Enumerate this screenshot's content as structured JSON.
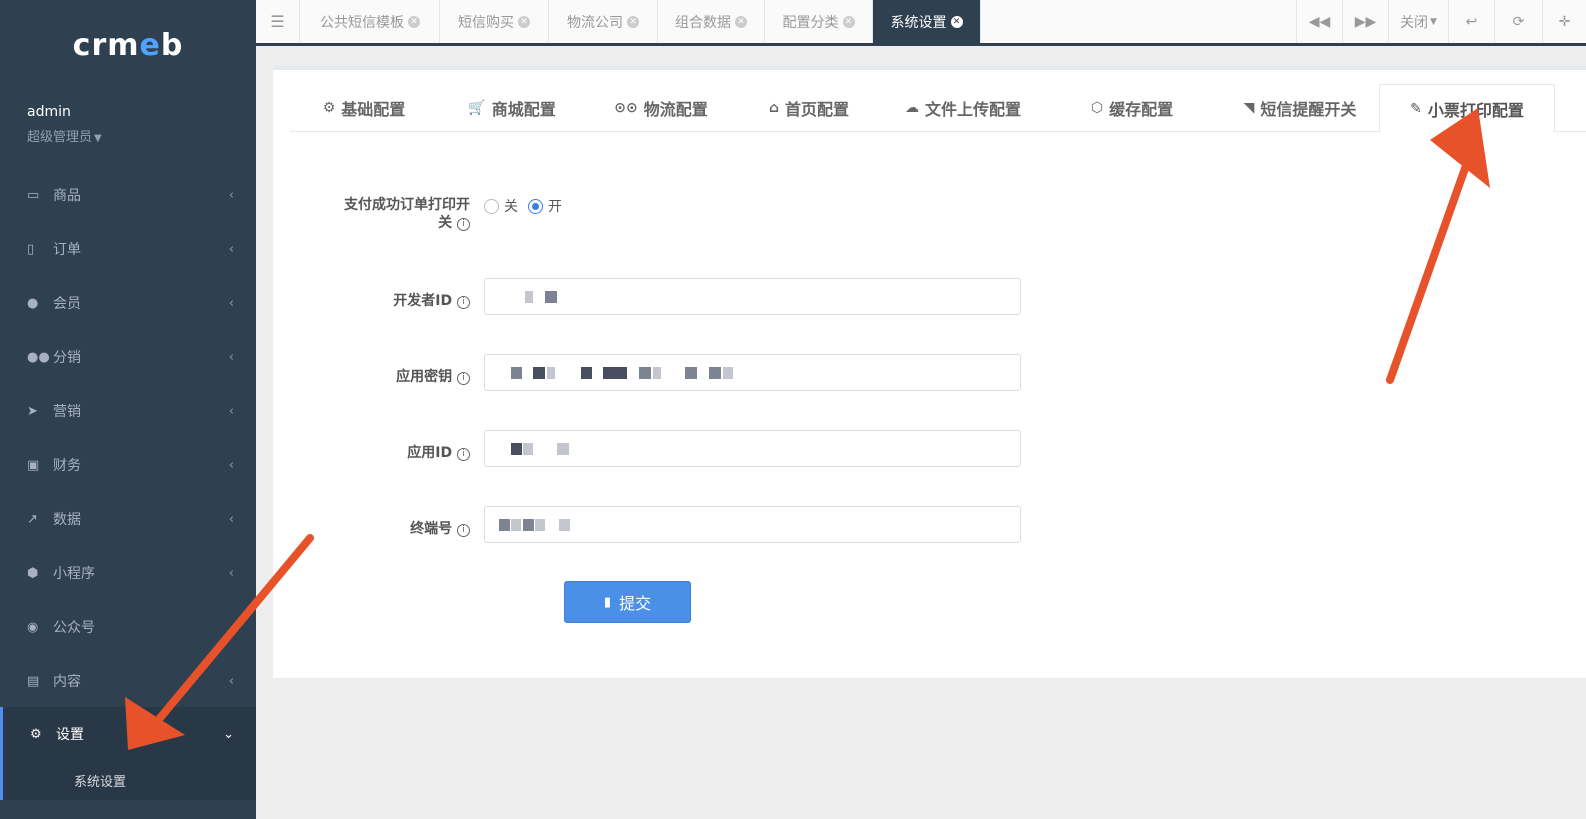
{
  "app": {
    "logo": "crmeb",
    "user": {
      "name": "admin",
      "role": "超级管理员"
    }
  },
  "sidebar": {
    "items": [
      {
        "label": "商品",
        "icon": "laptop-icon",
        "glyph": "💻"
      },
      {
        "label": "订单",
        "icon": "building-icon",
        "glyph": "▦"
      },
      {
        "label": "会员",
        "icon": "user-icon",
        "glyph": "●"
      },
      {
        "label": "分销",
        "icon": "users-icon",
        "glyph": "👥"
      },
      {
        "label": "营销",
        "icon": "paper-plane-icon",
        "glyph": "➤"
      },
      {
        "label": "财务",
        "icon": "money-icon",
        "glyph": "▣"
      },
      {
        "label": "数据",
        "icon": "line-chart-icon",
        "glyph": "📈"
      },
      {
        "label": "小程序",
        "icon": "cubes-icon",
        "glyph": "⬢"
      },
      {
        "label": "公众号",
        "icon": "wechat-icon",
        "glyph": "💬"
      },
      {
        "label": "内容",
        "icon": "newspaper-icon",
        "glyph": "▤"
      },
      {
        "label": "设置",
        "icon": "gear-icon",
        "glyph": "⚙"
      }
    ],
    "sub_item": "系统设置"
  },
  "topbar": {
    "tabs": [
      {
        "label": "公共短信模板"
      },
      {
        "label": "短信购买"
      },
      {
        "label": "物流公司"
      },
      {
        "label": "组合数据"
      },
      {
        "label": "配置分类"
      },
      {
        "label": "系统设置"
      }
    ],
    "close_label": "关闭"
  },
  "config_tabs": [
    {
      "label": "基础配置",
      "icon": "gear-icon",
      "glyph": "⚙"
    },
    {
      "label": "商城配置",
      "icon": "cart-icon",
      "glyph": "🛒"
    },
    {
      "label": "物流配置",
      "icon": "motorcycle-icon",
      "glyph": "🏍"
    },
    {
      "label": "首页配置",
      "icon": "home-icon",
      "glyph": "⌂"
    },
    {
      "label": "文件上传配置",
      "icon": "cloud-upload-icon",
      "glyph": "☁"
    },
    {
      "label": "缓存配置",
      "icon": "cube-icon",
      "glyph": "⬡"
    },
    {
      "label": "短信提醒开关",
      "icon": "rss-icon",
      "glyph": "◠"
    },
    {
      "label": "小票打印配置",
      "icon": "plug-icon",
      "glyph": "🔌"
    }
  ],
  "form": {
    "print_switch": {
      "label_line1": "支付成功订单打印开",
      "label_line2": "关",
      "options": [
        "关",
        "开"
      ],
      "selected": "开"
    },
    "developer_id": {
      "label": "开发者ID"
    },
    "app_secret": {
      "label": "应用密钥"
    },
    "app_id": {
      "label": "应用ID"
    },
    "terminal_no": {
      "label": "终端号"
    },
    "submit_label": "提交"
  },
  "colors": {
    "sidebar_bg": "#2f4050",
    "accent": "#4a90e8",
    "annotation_arrow": "#e8522a"
  }
}
